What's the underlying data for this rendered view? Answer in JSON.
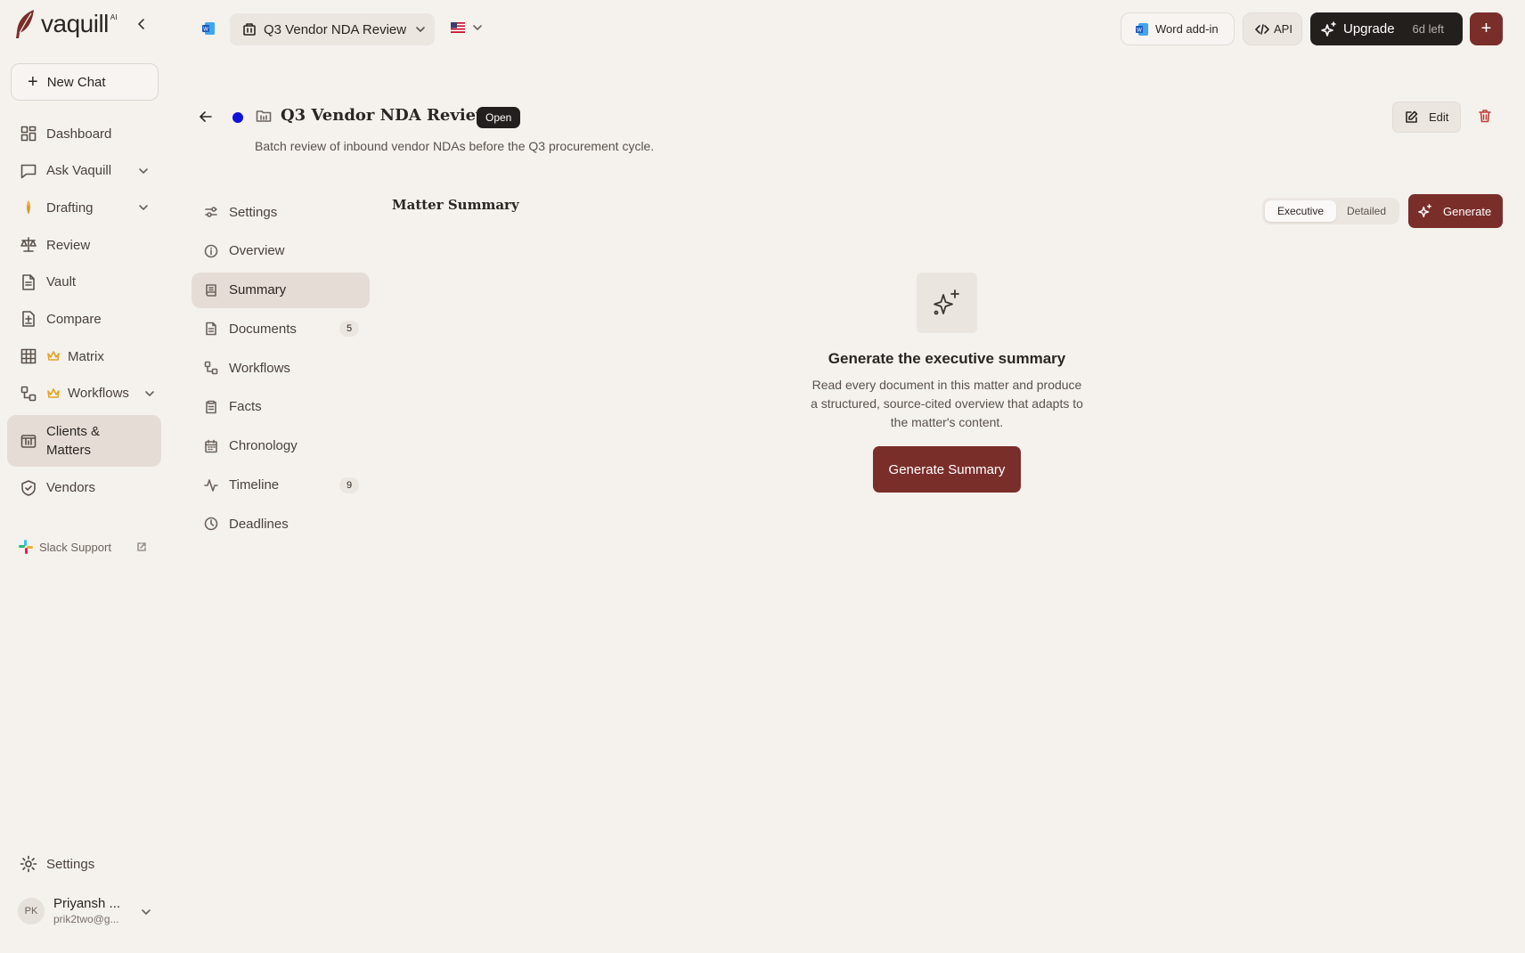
{
  "app": {
    "name": "vaquill",
    "name_sup": "AI"
  },
  "sidebar": {
    "new_chat": "New Chat",
    "items": [
      {
        "label": "Dashboard",
        "icon": "dashboard-icon"
      },
      {
        "label": "Ask Vaquill",
        "icon": "chat-icon",
        "expandable": true
      },
      {
        "label": "Drafting",
        "icon": "pen-icon",
        "expandable": true
      },
      {
        "label": "Review",
        "icon": "scale-icon"
      },
      {
        "label": "Vault",
        "icon": "file-icon"
      },
      {
        "label": "Compare",
        "icon": "compare-icon"
      },
      {
        "label": "Matrix",
        "icon": "grid-icon",
        "premium": true
      },
      {
        "label": "Workflows",
        "icon": "workflow-icon",
        "premium": true,
        "expandable": true
      },
      {
        "label": "Clients & Matters",
        "icon": "matters-icon",
        "active": true
      },
      {
        "label": "Vendors",
        "icon": "shield-icon"
      }
    ],
    "slack_support": "Slack Support",
    "settings": "Settings",
    "user": {
      "initials": "PK",
      "name": "Priyansh ...",
      "email": "prik2two@g..."
    }
  },
  "topbar": {
    "matter_selector": "Q3 Vendor NDA Review",
    "word_addin": "Word add-in",
    "api": "API",
    "upgrade": "Upgrade",
    "trial_left": "6d left"
  },
  "matter": {
    "title": "Q3 Vendor NDA Review",
    "status": "Open",
    "description": "Batch review of inbound vendor NDAs before the Q3 procurement cycle.",
    "edit_label": "Edit"
  },
  "subnav": [
    {
      "label": "Settings",
      "icon": "sliders-icon"
    },
    {
      "label": "Overview",
      "icon": "info-icon"
    },
    {
      "label": "Summary",
      "icon": "summary-icon",
      "active": true
    },
    {
      "label": "Documents",
      "icon": "document-icon",
      "count": "5"
    },
    {
      "label": "Workflows",
      "icon": "workflow-icon"
    },
    {
      "label": "Facts",
      "icon": "clipboard-icon"
    },
    {
      "label": "Chronology",
      "icon": "calendar-icon"
    },
    {
      "label": "Timeline",
      "icon": "activity-icon",
      "count": "9"
    },
    {
      "label": "Deadlines",
      "icon": "clock-icon"
    }
  ],
  "summary": {
    "heading": "Matter Summary",
    "mode_options": [
      "Executive",
      "Detailed"
    ],
    "selected_mode": "Executive",
    "generate_label": "Generate",
    "empty_title": "Generate the executive summary",
    "empty_description": "Read every document in this matter and produce a structured, source-cited overview that adapts to the matter's content.",
    "generate_summary_label": "Generate Summary"
  },
  "colors": {
    "background": "#f5f1ed",
    "accent": "#7a2e2a",
    "dark": "#231f1d",
    "status_dot": "#1212d9",
    "delete": "#c0403a",
    "crown": "#e0a526"
  }
}
